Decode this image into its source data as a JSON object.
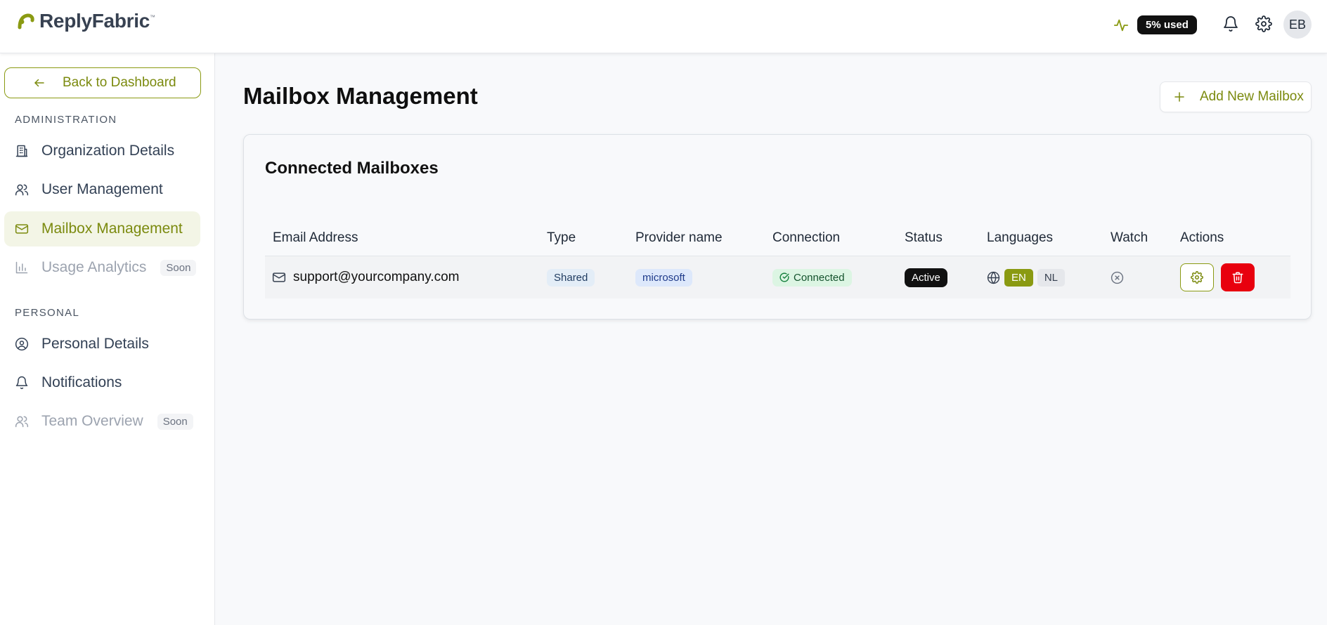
{
  "header": {
    "logo_text": "ReplyFabric",
    "logo_tm": "™",
    "usage_label": "5% used",
    "avatar_initials": "EB"
  },
  "sidebar": {
    "back_label": "Back to Dashboard",
    "section_admin": "ADMINISTRATION",
    "section_personal": "PERSONAL",
    "soon_label": "Soon",
    "items": [
      {
        "label": "Organization Details",
        "icon": "building-icon",
        "state": "normal"
      },
      {
        "label": "User Management",
        "icon": "users-icon",
        "state": "normal"
      },
      {
        "label": "Mailbox Management",
        "icon": "mail-icon",
        "state": "active"
      },
      {
        "label": "Usage Analytics",
        "icon": "bar-chart-icon",
        "state": "disabled"
      },
      {
        "label": "Personal Details",
        "icon": "user-circle-icon",
        "state": "normal"
      },
      {
        "label": "Notifications",
        "icon": "bell-icon",
        "state": "normal"
      },
      {
        "label": "Team Overview",
        "icon": "users-icon",
        "state": "disabled"
      }
    ]
  },
  "main": {
    "page_title": "Mailbox Management",
    "add_button_label": "Add New Mailbox",
    "card_title": "Connected Mailboxes",
    "columns": [
      "Email Address",
      "Type",
      "Provider name",
      "Connection",
      "Status",
      "Languages",
      "Watch",
      "Actions"
    ],
    "rows": [
      {
        "email": "support@yourcompany.com",
        "type": "Shared",
        "provider": "microsoft",
        "connection": "Connected",
        "status": "Active",
        "languages": [
          "EN",
          "NL"
        ],
        "active_language": "EN"
      }
    ]
  },
  "colors": {
    "accent": "#8a9a12",
    "danger": "#e8000e",
    "active_bg": "#f3f5e6"
  }
}
